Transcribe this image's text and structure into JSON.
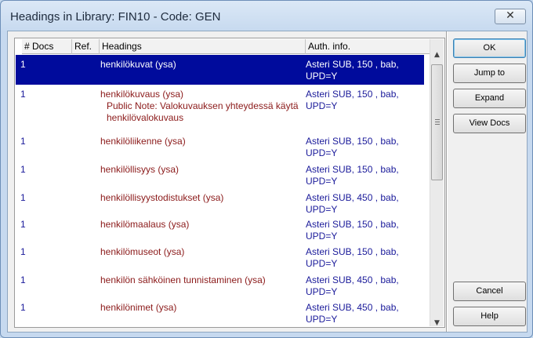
{
  "window": {
    "title": "Headings in Library: FIN10 - Code: GEN",
    "close_glyph": "✕"
  },
  "columns": [
    "# Docs",
    "Ref.",
    "Headings",
    "Auth. info."
  ],
  "rows": [
    {
      "docs": "1",
      "heading": "henkilökuvat (ysa)",
      "auth": "Asteri SUB, 150 , bab, UPD=Y",
      "selected": true
    },
    {
      "docs": "1",
      "heading": "henkilökuvaus (ysa)",
      "note": "Public Note: Valokuvauksen yhteydessä käytä henkilövalokuvaus",
      "auth": "Asteri SUB, 150 , bab, UPD=Y"
    },
    {
      "docs": "1",
      "heading": "henkilöliikenne (ysa)",
      "auth": "Asteri SUB, 150 , bab, UPD=Y"
    },
    {
      "docs": "1",
      "heading": "henkilöllisyys (ysa)",
      "auth": "Asteri SUB, 150 , bab, UPD=Y"
    },
    {
      "docs": "1",
      "heading": "henkilöllisyystodistukset (ysa)",
      "auth": "Asteri SUB, 450 , bab, UPD=Y"
    },
    {
      "docs": "1",
      "heading": "henkilömaalaus (ysa)",
      "auth": "Asteri SUB, 150 , bab, UPD=Y"
    },
    {
      "docs": "1",
      "heading": "henkilömuseot (ysa)",
      "auth": "Asteri SUB, 150 , bab, UPD=Y"
    },
    {
      "docs": "1",
      "heading": "henkilön sähköinen tunnistaminen (ysa)",
      "auth": "Asteri SUB, 450 , bab, UPD=Y"
    },
    {
      "docs": "1",
      "heading": "henkilönimet (ysa)",
      "auth": "Asteri SUB, 450 , bab, UPD=Y"
    }
  ],
  "buttons": {
    "ok": "OK",
    "jump_to": "Jump to",
    "expand": "Expand",
    "view_docs": "View Docs",
    "cancel": "Cancel",
    "help": "Help"
  },
  "scrollbar": {
    "up_glyph": "▲",
    "down_glyph": "▼"
  },
  "colors": {
    "selection": "#000b9c",
    "heading_text": "#8b1a1a",
    "docs_text": "#1a1a9a"
  }
}
